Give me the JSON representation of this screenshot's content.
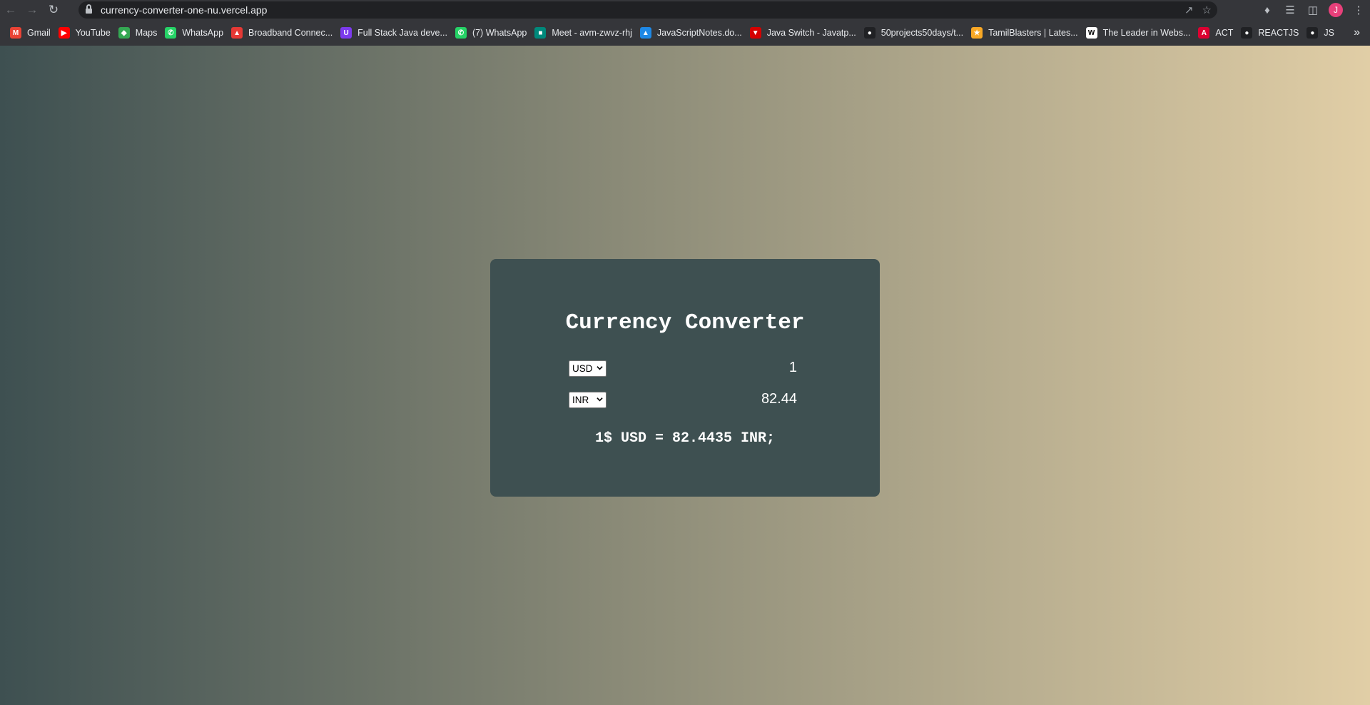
{
  "browser": {
    "url": "currency-converter-one-nu.vercel.app",
    "profile_initial": "J",
    "bookmarks": [
      {
        "label": "Gmail",
        "icon": "gmail-icon",
        "color": "#ea4335",
        "glyph": "M"
      },
      {
        "label": "YouTube",
        "icon": "youtube-icon",
        "color": "#ff0000",
        "glyph": "▶"
      },
      {
        "label": "Maps",
        "icon": "maps-icon",
        "color": "#34a853",
        "glyph": "◆"
      },
      {
        "label": "WhatsApp",
        "icon": "whatsapp-icon",
        "color": "#25d366",
        "glyph": "✆"
      },
      {
        "label": "Broadband Connec...",
        "icon": "broadband-icon",
        "color": "#e53935",
        "glyph": "▲"
      },
      {
        "label": "Full Stack Java deve...",
        "icon": "course-icon",
        "color": "#7c3aed",
        "glyph": "U"
      },
      {
        "label": "(7) WhatsApp",
        "icon": "whatsapp-icon",
        "color": "#25d366",
        "glyph": "✆"
      },
      {
        "label": "Meet - avm-zwvz-rhj",
        "icon": "meet-icon",
        "color": "#00897b",
        "glyph": "■"
      },
      {
        "label": "JavaScriptNotes.do...",
        "icon": "drive-icon",
        "color": "#1e88e5",
        "glyph": "▲"
      },
      {
        "label": "Java Switch - Javatp...",
        "icon": "javatpoint-icon",
        "color": "#d50000",
        "glyph": "▼"
      },
      {
        "label": "50projects50days/t...",
        "icon": "github-icon",
        "color": "#202124",
        "glyph": "●"
      },
      {
        "label": "TamilBlasters | Lates...",
        "icon": "tamilblasters-icon",
        "color": "#f9a825",
        "glyph": "★"
      },
      {
        "label": "The Leader in Webs...",
        "icon": "wix-icon",
        "color": "#ffffff",
        "glyph": "W"
      },
      {
        "label": "ACT",
        "icon": "angular-icon",
        "color": "#dd0031",
        "glyph": "A"
      },
      {
        "label": "REACTJS",
        "icon": "github-icon",
        "color": "#202124",
        "glyph": "●"
      },
      {
        "label": "JS",
        "icon": "github-icon",
        "color": "#202124",
        "glyph": "●"
      }
    ]
  },
  "app": {
    "title": "Currency Converter",
    "from": {
      "currency": "USD",
      "amount": "1"
    },
    "to": {
      "currency": "INR",
      "amount": "82.44"
    },
    "rate_text": "1$ USD = 82.4435 INR;"
  }
}
